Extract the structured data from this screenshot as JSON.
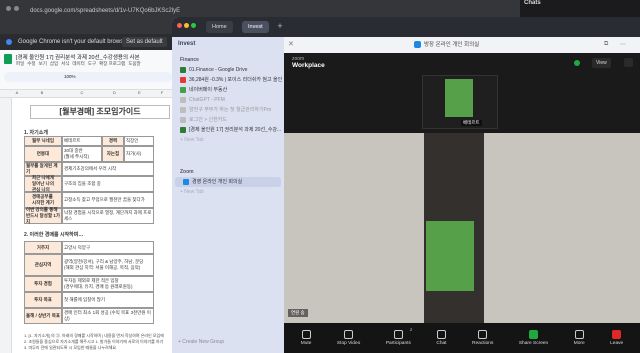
{
  "chrome": {
    "url": "docs.google.com/spreadsheets/d/1v-U7KQo6bJKSc2lyEZ4lEHqH36fQfYRYHD5SVhRX4j/edit?gid=1689779057#gid=1689779057",
    "infobar_text": "Google Chrome isn't your default browser",
    "infobar_button": "Set as default"
  },
  "sheets": {
    "title": "[경제 올인원 17] 권리분석 과제 20선_수강생용의 사본",
    "menu": [
      "파일",
      "수정",
      "보기",
      "삽입",
      "서식",
      "데이터",
      "도구",
      "확장 프로그램",
      "도움말"
    ],
    "zoom": "100%",
    "columns": [
      "A",
      "B",
      "C",
      "D",
      "E",
      "F",
      "G"
    ],
    "doc_title": "[월부경매] 조모임가이드",
    "section1": "1. 자기소개",
    "section2": "2. 이러한 경매를 시작하며…",
    "rows1": [
      {
        "label": "월부 닉네임",
        "value": "베테르트",
        "label2": "경력",
        "value2": "직장인"
      },
      {
        "label": "연봉대",
        "value": "30대 중반\n(월세 쭈시작)",
        "label2": "자는집",
        "value2": "자가(사)"
      },
      {
        "label": "월부를 알게된 계기",
        "value": "경제기초강의에서 우러 시작"
      },
      {
        "label": "최근 나에게\n일어난 나의\n관심 나의",
        "value": "구조의 집을 조합 중"
      },
      {
        "label": "경매공부를\n시작한 계기",
        "value": "고정소득 찾고 부업으로 월천만 꿈을 찾다가"
      },
      {
        "label": "이번 강의를 통해\n반드시 달성할 1가지",
        "value": "낙찰 경험을 시작으로 열정, 계단까지 과제 프로세스"
      }
    ],
    "rows2": [
      {
        "label": "거주지",
        "value": "고양시 덕양구"
      },
      {
        "label": "관심지역",
        "value": "광역(양천/강서), 구리 & 남양주, 하남, 분당\n(해외 관심 지역: 서울 이해공, 목적, 음악)"
      },
      {
        "label": "투자 경험",
        "value": "투자동 제외로 제한 적은 입찰\n(경우에대, 유지, 경매 등 원래로원동)"
      },
      {
        "label": "투자 목표",
        "value": "첫 해를에 입찰이 많기"
      },
      {
        "label": "올해 / 상반기 목표",
        "value": "경매 인터 최소 1회 성공 (수익 목표 3천만원 이상)"
      }
    ],
    "footer_lines": [
      "1. [1. 자기소개] 의 ③. 아래의 경매를 시작하며 | 내용을 먼저 작성하며 온라인 모임에",
      "2. 조원들을 중심으로 자기소개를 해주시고 1. 발가들 이야기에 서로의 이야기를 하기"
    ],
    "footer_small": "3. 마무리 전에 일관되도록 시 모임한 때들을 나누려해요."
  },
  "overlay": {
    "tab_home": "Home",
    "tab_invest": "Invest",
    "sidebar_header": "Invest",
    "finance_label": "Finance",
    "finance_items": [
      {
        "text": "01.Finance - Google Drive",
        "color": "#2e7d32"
      },
      {
        "text": "36,284원 -0.3% | 포이스 리더쉬카 첨고 올인",
        "color": "#e53935"
      },
      {
        "text": "네이버페이 부동산",
        "color": "#43a047"
      },
      {
        "text": "ChatGPT - PFM",
        "color": "#9e9e9e"
      },
      {
        "text": "양천구 부부가 하는 첫 월급관리하기Pro",
        "color": "#9e9e9e"
      },
      {
        "text": "로그인 > 신한카드",
        "color": "#9e9e9e"
      },
      {
        "text": "[경제 올인원 17] 권리분석 과제 20선_수강...",
        "color": "#2e7d32"
      }
    ],
    "new_tab_1": "+ New Tab",
    "zoom_label": "Zoom",
    "zoom_items": [
      {
        "text": "경영 온라인 개인 회의실",
        "color": "#1e88e5"
      }
    ],
    "new_tab_2": "+ New Tab",
    "new_group": "+ Create New Group"
  },
  "zoom": {
    "url_title": "방장 온라인 개인 회의실",
    "brand_line1": "zoom",
    "brand_line2": "Workplace",
    "view_label": "View",
    "self_name": "베테르트",
    "main_name": "연원 숨",
    "toolbar": [
      {
        "label": "Mute",
        "icon": "mic-icon"
      },
      {
        "label": "Stop Video",
        "icon": "video-icon"
      },
      {
        "label": "Participants",
        "icon": "participants-icon"
      },
      {
        "label": "Chat",
        "icon": "chat-icon"
      },
      {
        "label": "Reactions",
        "icon": "reactions-icon"
      },
      {
        "label": "Share Screen",
        "icon": "share-screen-icon"
      },
      {
        "label": "More",
        "icon": "more-icon"
      },
      {
        "label": "Leave",
        "icon": "leave-icon"
      }
    ],
    "participant_count": "2",
    "leave_color": "#e02828",
    "share_color": "#1eaa3f"
  },
  "right_panel": {
    "label": "Chats"
  }
}
